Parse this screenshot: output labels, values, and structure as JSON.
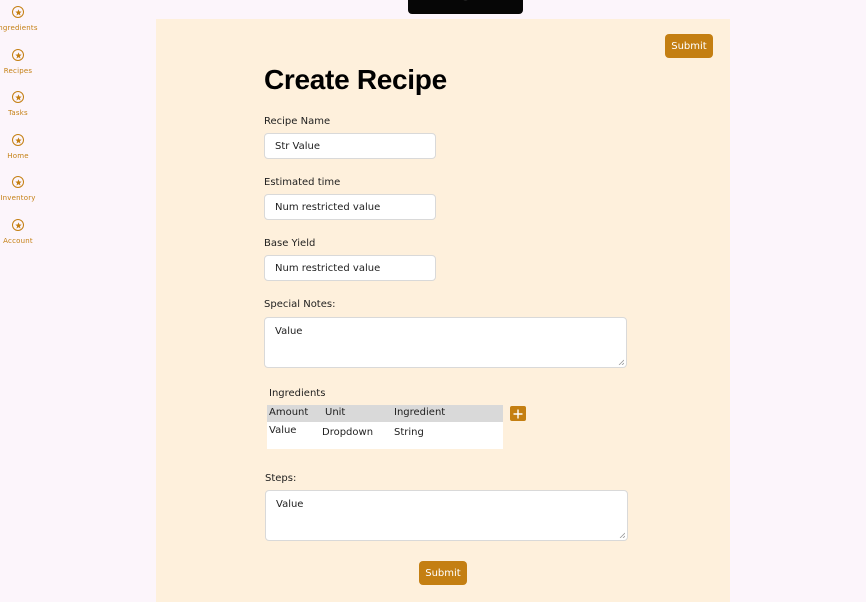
{
  "nav": {
    "items": [
      {
        "label": "ngredients",
        "icon": "star-icon"
      },
      {
        "label": "Recipes",
        "icon": "star-icon"
      },
      {
        "label": "Tasks",
        "icon": "star-icon"
      },
      {
        "label": "Home",
        "icon": "star-icon"
      },
      {
        "label": "Inventory",
        "icon": "star-icon"
      },
      {
        "label": "Account",
        "icon": "star-icon"
      }
    ]
  },
  "form": {
    "title": "Create Recipe",
    "top_submit": "Submit",
    "bottom_submit": "Submit",
    "recipe_name": {
      "label": "Recipe Name",
      "value": "Str Value"
    },
    "estimated_time": {
      "label": "Estimated time",
      "value": "Num restricted value"
    },
    "base_yield": {
      "label": "Base Yield",
      "value": "Num restricted value"
    },
    "special_notes": {
      "label": "Special Notes:",
      "value": "Value"
    },
    "ingredients": {
      "label": "Ingredients",
      "columns": [
        "Amount",
        "Unit",
        "Ingredient"
      ],
      "rows": [
        [
          "Value",
          "Dropdown",
          "String"
        ]
      ],
      "add_icon": "plus-icon"
    },
    "steps": {
      "label": "Steps:",
      "value": "Value"
    }
  },
  "colors": {
    "accent": "#c47f12",
    "panel_bg": "#fef0dc",
    "page_bg": "#fcf5fb",
    "table_header": "#d9d9d9"
  }
}
